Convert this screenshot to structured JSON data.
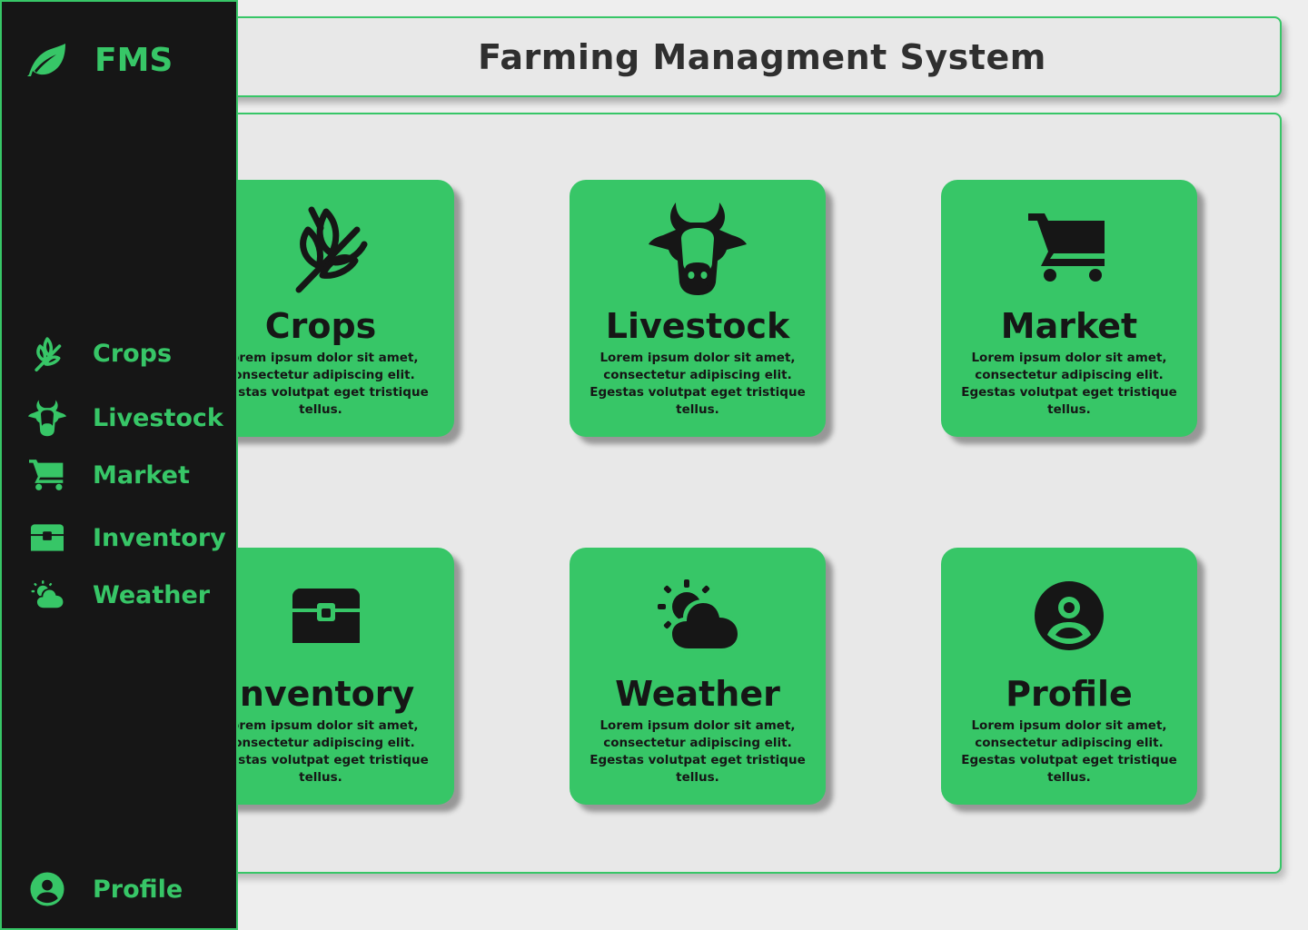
{
  "header": {
    "title": "Farming Managment System"
  },
  "sidebar": {
    "brand": {
      "text": "FMS",
      "icon": "leaf-icon"
    },
    "items": [
      {
        "label": "Crops",
        "icon": "wheat-icon"
      },
      {
        "label": "Livestock",
        "icon": "cow-icon"
      },
      {
        "label": "Market",
        "icon": "cart-icon"
      },
      {
        "label": "Inventory",
        "icon": "chest-icon"
      },
      {
        "label": "Weather",
        "icon": "sun-cloud-icon"
      }
    ],
    "profile": {
      "label": "Profile",
      "icon": "user-circle-icon"
    }
  },
  "cards": [
    {
      "title": "Crops",
      "icon": "wheat-icon",
      "description": "Lorem ipsum dolor sit amet, consectetur adipiscing elit. Egestas volutpat eget tristique tellus."
    },
    {
      "title": "Livestock",
      "icon": "cow-icon",
      "description": "Lorem ipsum dolor sit amet, consectetur adipiscing elit. Egestas volutpat eget tristique tellus."
    },
    {
      "title": "Market",
      "icon": "cart-icon",
      "description": "Lorem ipsum dolor sit amet, consectetur adipiscing elit. Egestas volutpat eget tristique tellus."
    },
    {
      "title": "Inventory",
      "icon": "chest-icon",
      "description": "Lorem ipsum dolor sit amet, consectetur adipiscing elit. Egestas volutpat eget tristique tellus."
    },
    {
      "title": "Weather",
      "icon": "sun-cloud-icon",
      "description": "Lorem ipsum dolor sit amet, consectetur adipiscing elit. Egestas volutpat eget tristique tellus."
    },
    {
      "title": "Profile",
      "icon": "user-circle-icon",
      "description": "Lorem ipsum dolor sit amet, consectetur adipiscing elit. Egestas volutpat eget tristique tellus."
    }
  ],
  "colors": {
    "accent": "#37c667",
    "sidebar_bg": "#161616",
    "page_bg": "#eeeeee",
    "text_dark": "#161616"
  }
}
